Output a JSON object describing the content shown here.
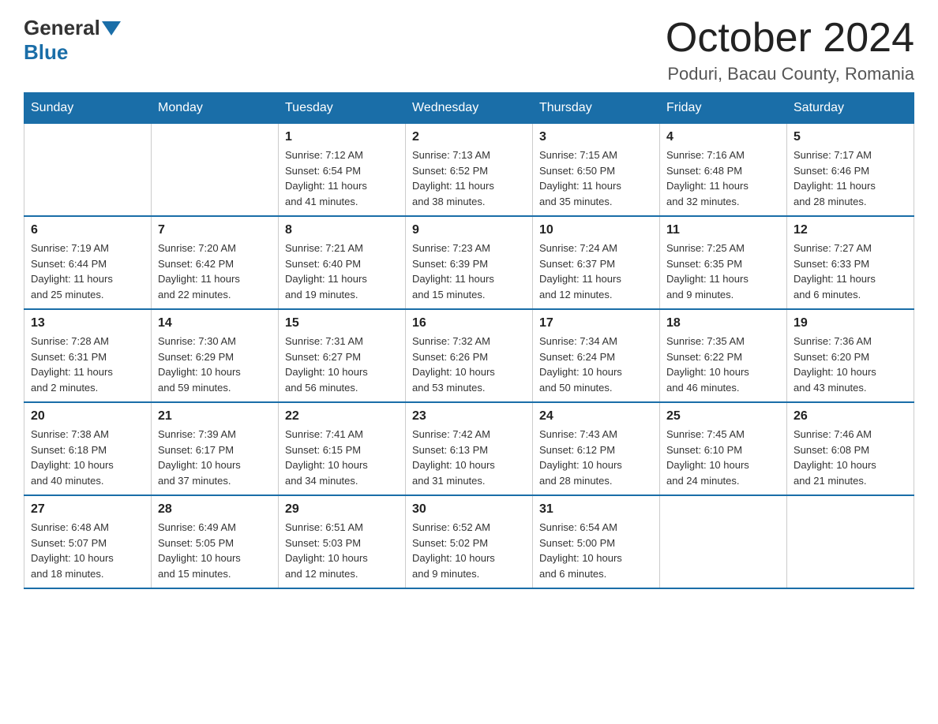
{
  "header": {
    "logo_general": "General",
    "logo_blue": "Blue",
    "month_title": "October 2024",
    "location": "Poduri, Bacau County, Romania"
  },
  "days_of_week": [
    "Sunday",
    "Monday",
    "Tuesday",
    "Wednesday",
    "Thursday",
    "Friday",
    "Saturday"
  ],
  "weeks": [
    [
      {
        "day": "",
        "info": ""
      },
      {
        "day": "",
        "info": ""
      },
      {
        "day": "1",
        "info": "Sunrise: 7:12 AM\nSunset: 6:54 PM\nDaylight: 11 hours\nand 41 minutes."
      },
      {
        "day": "2",
        "info": "Sunrise: 7:13 AM\nSunset: 6:52 PM\nDaylight: 11 hours\nand 38 minutes."
      },
      {
        "day": "3",
        "info": "Sunrise: 7:15 AM\nSunset: 6:50 PM\nDaylight: 11 hours\nand 35 minutes."
      },
      {
        "day": "4",
        "info": "Sunrise: 7:16 AM\nSunset: 6:48 PM\nDaylight: 11 hours\nand 32 minutes."
      },
      {
        "day": "5",
        "info": "Sunrise: 7:17 AM\nSunset: 6:46 PM\nDaylight: 11 hours\nand 28 minutes."
      }
    ],
    [
      {
        "day": "6",
        "info": "Sunrise: 7:19 AM\nSunset: 6:44 PM\nDaylight: 11 hours\nand 25 minutes."
      },
      {
        "day": "7",
        "info": "Sunrise: 7:20 AM\nSunset: 6:42 PM\nDaylight: 11 hours\nand 22 minutes."
      },
      {
        "day": "8",
        "info": "Sunrise: 7:21 AM\nSunset: 6:40 PM\nDaylight: 11 hours\nand 19 minutes."
      },
      {
        "day": "9",
        "info": "Sunrise: 7:23 AM\nSunset: 6:39 PM\nDaylight: 11 hours\nand 15 minutes."
      },
      {
        "day": "10",
        "info": "Sunrise: 7:24 AM\nSunset: 6:37 PM\nDaylight: 11 hours\nand 12 minutes."
      },
      {
        "day": "11",
        "info": "Sunrise: 7:25 AM\nSunset: 6:35 PM\nDaylight: 11 hours\nand 9 minutes."
      },
      {
        "day": "12",
        "info": "Sunrise: 7:27 AM\nSunset: 6:33 PM\nDaylight: 11 hours\nand 6 minutes."
      }
    ],
    [
      {
        "day": "13",
        "info": "Sunrise: 7:28 AM\nSunset: 6:31 PM\nDaylight: 11 hours\nand 2 minutes."
      },
      {
        "day": "14",
        "info": "Sunrise: 7:30 AM\nSunset: 6:29 PM\nDaylight: 10 hours\nand 59 minutes."
      },
      {
        "day": "15",
        "info": "Sunrise: 7:31 AM\nSunset: 6:27 PM\nDaylight: 10 hours\nand 56 minutes."
      },
      {
        "day": "16",
        "info": "Sunrise: 7:32 AM\nSunset: 6:26 PM\nDaylight: 10 hours\nand 53 minutes."
      },
      {
        "day": "17",
        "info": "Sunrise: 7:34 AM\nSunset: 6:24 PM\nDaylight: 10 hours\nand 50 minutes."
      },
      {
        "day": "18",
        "info": "Sunrise: 7:35 AM\nSunset: 6:22 PM\nDaylight: 10 hours\nand 46 minutes."
      },
      {
        "day": "19",
        "info": "Sunrise: 7:36 AM\nSunset: 6:20 PM\nDaylight: 10 hours\nand 43 minutes."
      }
    ],
    [
      {
        "day": "20",
        "info": "Sunrise: 7:38 AM\nSunset: 6:18 PM\nDaylight: 10 hours\nand 40 minutes."
      },
      {
        "day": "21",
        "info": "Sunrise: 7:39 AM\nSunset: 6:17 PM\nDaylight: 10 hours\nand 37 minutes."
      },
      {
        "day": "22",
        "info": "Sunrise: 7:41 AM\nSunset: 6:15 PM\nDaylight: 10 hours\nand 34 minutes."
      },
      {
        "day": "23",
        "info": "Sunrise: 7:42 AM\nSunset: 6:13 PM\nDaylight: 10 hours\nand 31 minutes."
      },
      {
        "day": "24",
        "info": "Sunrise: 7:43 AM\nSunset: 6:12 PM\nDaylight: 10 hours\nand 28 minutes."
      },
      {
        "day": "25",
        "info": "Sunrise: 7:45 AM\nSunset: 6:10 PM\nDaylight: 10 hours\nand 24 minutes."
      },
      {
        "day": "26",
        "info": "Sunrise: 7:46 AM\nSunset: 6:08 PM\nDaylight: 10 hours\nand 21 minutes."
      }
    ],
    [
      {
        "day": "27",
        "info": "Sunrise: 6:48 AM\nSunset: 5:07 PM\nDaylight: 10 hours\nand 18 minutes."
      },
      {
        "day": "28",
        "info": "Sunrise: 6:49 AM\nSunset: 5:05 PM\nDaylight: 10 hours\nand 15 minutes."
      },
      {
        "day": "29",
        "info": "Sunrise: 6:51 AM\nSunset: 5:03 PM\nDaylight: 10 hours\nand 12 minutes."
      },
      {
        "day": "30",
        "info": "Sunrise: 6:52 AM\nSunset: 5:02 PM\nDaylight: 10 hours\nand 9 minutes."
      },
      {
        "day": "31",
        "info": "Sunrise: 6:54 AM\nSunset: 5:00 PM\nDaylight: 10 hours\nand 6 minutes."
      },
      {
        "day": "",
        "info": ""
      },
      {
        "day": "",
        "info": ""
      }
    ]
  ]
}
